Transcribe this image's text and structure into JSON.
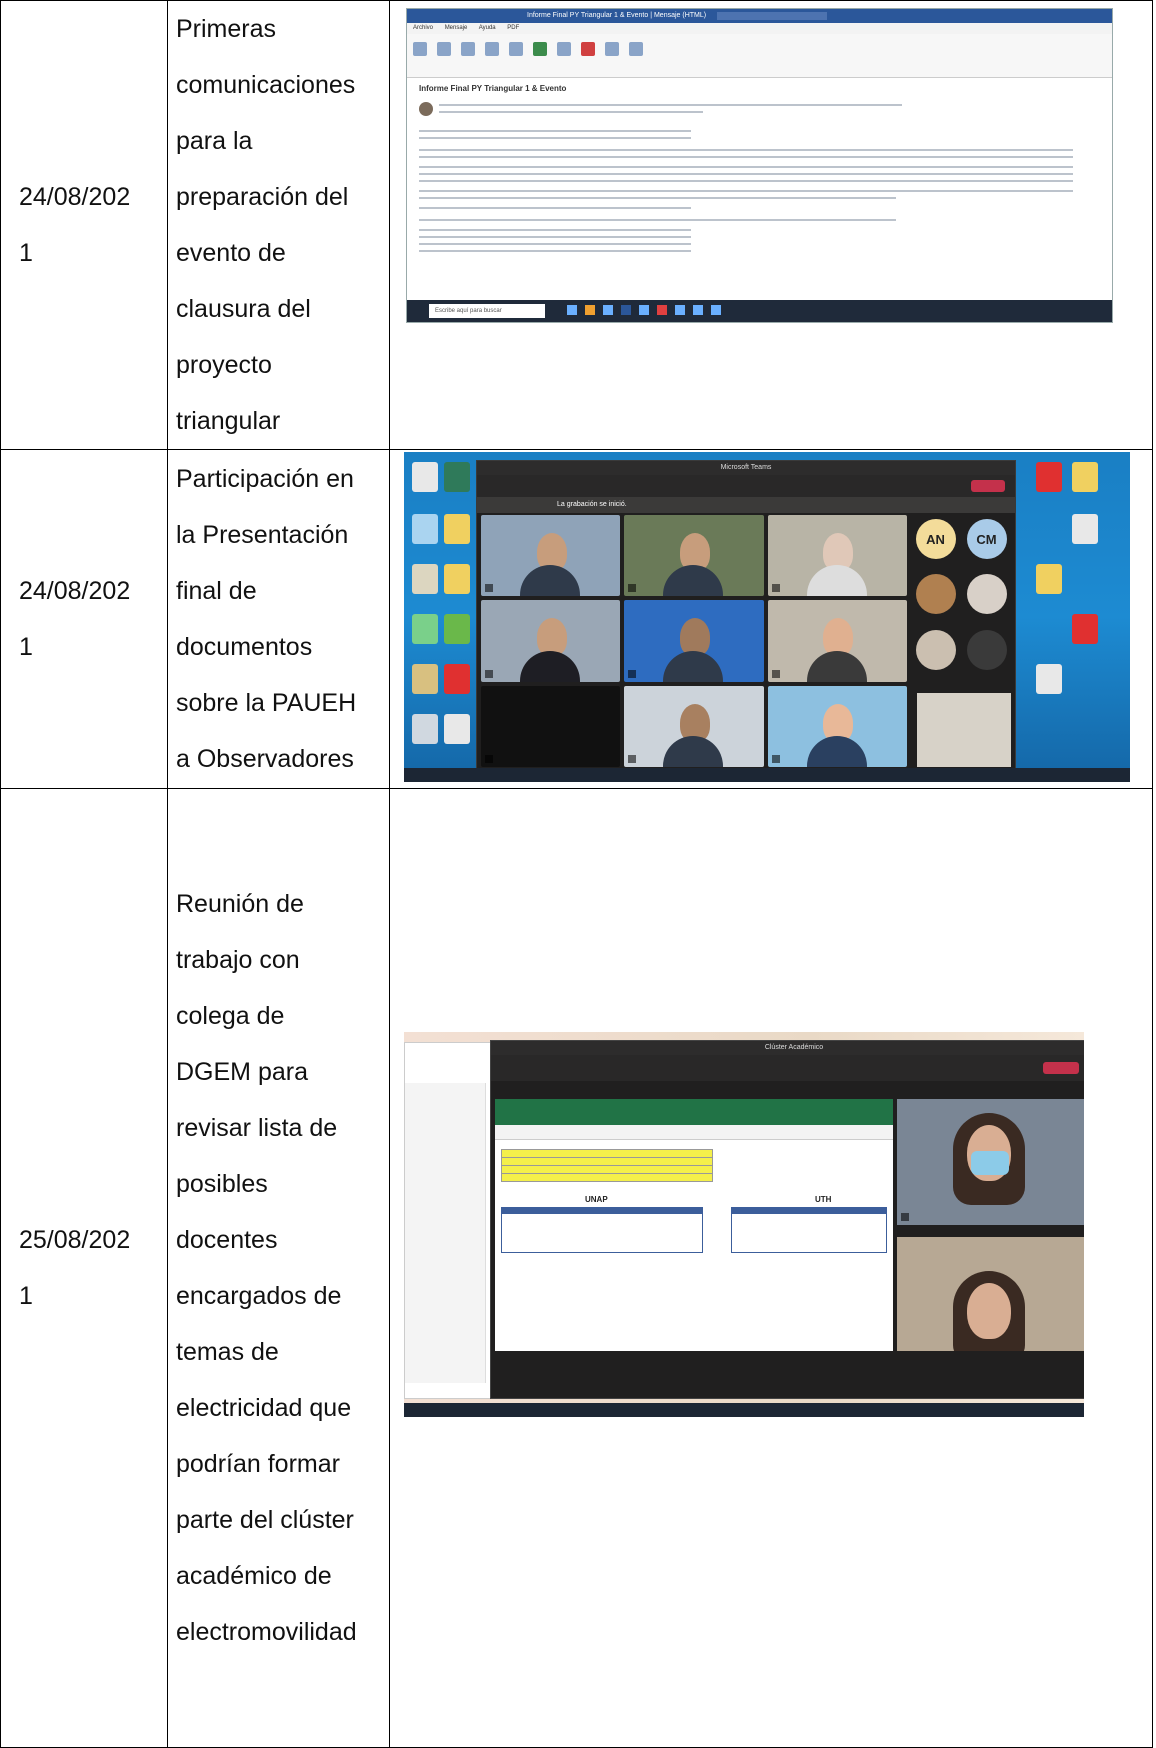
{
  "rows": [
    {
      "date": "24/08/202\n1",
      "description": "Primeras\ncomunicaciones\npara la\npreparación del\nevento de\nclausura del\nproyecto\ntriangular",
      "screenshot": {
        "kind": "outlook-email",
        "window_title": "Informe Final PY Triangular 1 & Evento | Mensaje (HTML)",
        "menu": [
          "Archivo",
          "Mensaje",
          "Ayuda",
          "PDF"
        ],
        "subject": "Informe Final PY Triangular 1 & Evento",
        "taskbar_search": "Escribe aquí para buscar"
      }
    },
    {
      "date": "24/08/202\n1",
      "description": "Participación en\nla Presentación\nfinal de\ndocumentos\nsobre la PAUEH\na Observadores",
      "screenshot": {
        "kind": "teams-meeting",
        "window_title": "Microsoft Teams",
        "banner": "La grabación se inició.",
        "participants_initials": [
          "AN",
          "CM"
        ]
      }
    },
    {
      "date": "25/08/202\n1",
      "description": "Reunión de\ntrabajo con\ncolega de\nDGEM para\nrevisar lista de\nposibles\ndocentes\nencargados de\ntemas de\nelectricidad que\npodrían formar\nparte del clúster\nacadémico de\nelectromovilidad",
      "screenshot": {
        "kind": "teams-excel",
        "window_title": "Clúster Académico",
        "sheet_headers": [
          "UNAP",
          "UTH"
        ]
      }
    }
  ],
  "colors": {
    "teams_leave": "#c4314b",
    "excel_green": "#217346",
    "outlook_blue": "#2b579a",
    "desktop_blue": "#1a7fc4"
  }
}
